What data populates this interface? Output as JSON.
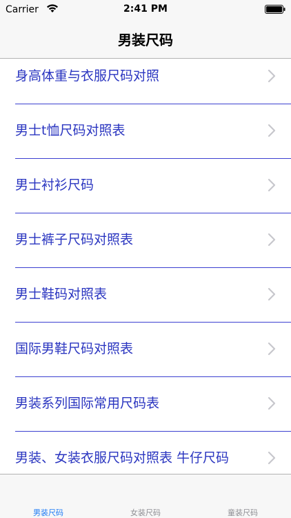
{
  "status_bar": {
    "carrier": "Carrier",
    "time": "2:41 PM"
  },
  "nav": {
    "title": "男装尺码"
  },
  "list": {
    "items": [
      {
        "label": "身高体重与衣服尺码对照"
      },
      {
        "label": "男士t恤尺码对照表"
      },
      {
        "label": "男士衬衫尺码"
      },
      {
        "label": "男士裤子尺码对照表"
      },
      {
        "label": "男士鞋码对照表"
      },
      {
        "label": "国际男鞋尺码对照表"
      },
      {
        "label": "男装系列国际常用尺码表"
      },
      {
        "label": "男装、女装衣服尺码对照表 牛仔尺码"
      }
    ]
  },
  "tabs": [
    {
      "label": "男装尺码",
      "active": true
    },
    {
      "label": "女装尺码",
      "active": false
    },
    {
      "label": "童装尺码",
      "active": false
    }
  ],
  "colors": {
    "accent": "#1f7cf5",
    "row_text": "#2a35c0",
    "separator": "#3b3fd0"
  }
}
